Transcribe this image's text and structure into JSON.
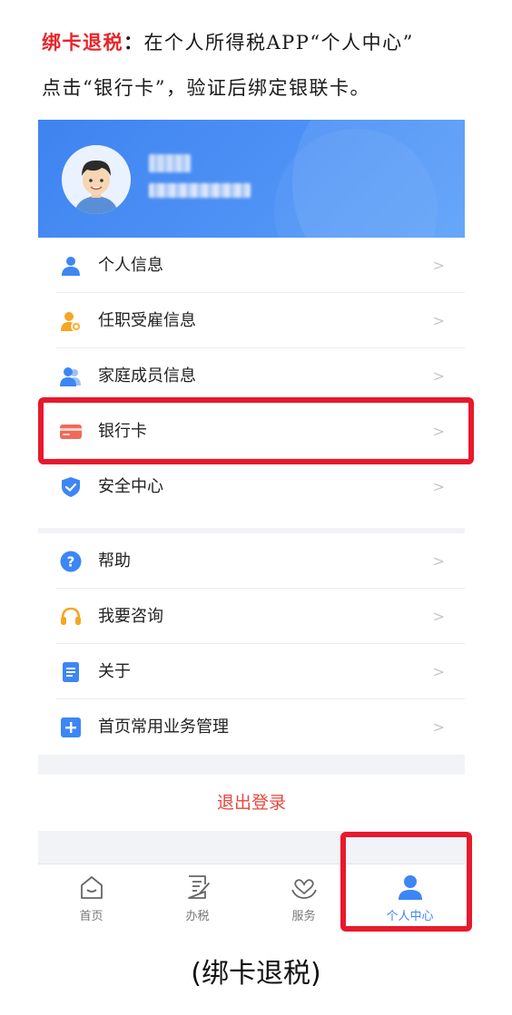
{
  "intro": {
    "highlight": "绑卡退税",
    "colon": "：",
    "line1_text": "在个人所得税APP“个人中心”",
    "line2_text": "点击“银行卡”，验证后绑定银联卡。"
  },
  "menu_group1": [
    {
      "label": "个人信息",
      "icon": "person-icon"
    },
    {
      "label": "任职受雇信息",
      "icon": "employment-icon"
    },
    {
      "label": "家庭成员信息",
      "icon": "family-icon"
    },
    {
      "label": "银行卡",
      "icon": "bank-card-icon"
    },
    {
      "label": "安全中心",
      "icon": "shield-icon"
    }
  ],
  "menu_group2": [
    {
      "label": "帮助",
      "icon": "help-icon"
    },
    {
      "label": "我要咨询",
      "icon": "headset-icon"
    },
    {
      "label": "关于",
      "icon": "document-icon"
    },
    {
      "label": "首页常用业务管理",
      "icon": "plus-box-icon"
    }
  ],
  "chevron": ">",
  "logout_label": "退出登录",
  "tabs": [
    {
      "label": "首页",
      "icon": "home-icon"
    },
    {
      "label": "办税",
      "icon": "tax-form-icon"
    },
    {
      "label": "服务",
      "icon": "service-heart-icon"
    },
    {
      "label": "个人中心",
      "icon": "user-icon",
      "active": true
    }
  ],
  "caption": "(绑卡退税)",
  "colors": {
    "accent": "#3c86f5",
    "highlight_red": "#e8192c",
    "logout_red": "#e8473c"
  }
}
